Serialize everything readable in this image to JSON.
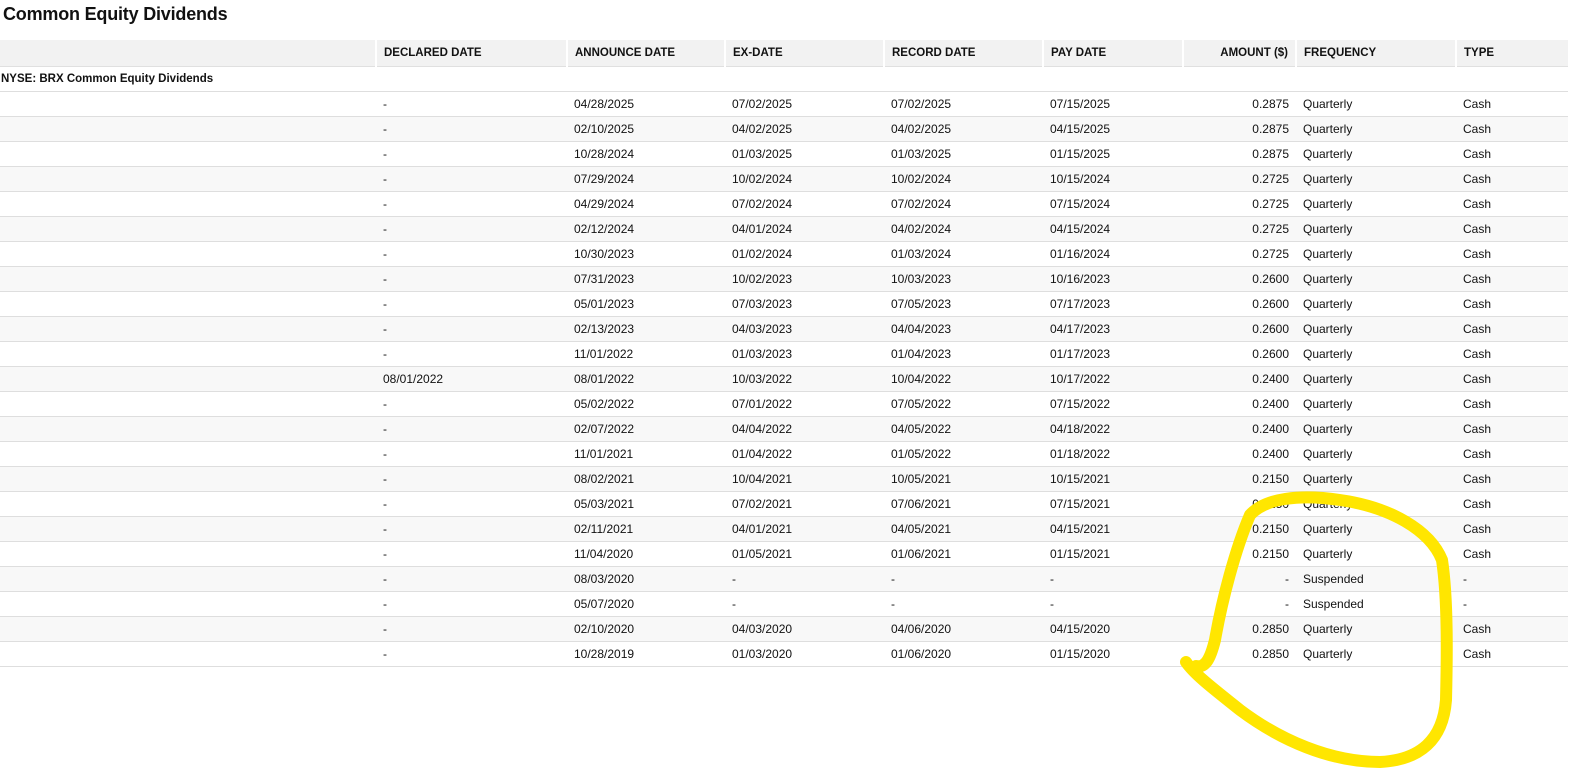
{
  "title": "Common Equity Dividends",
  "columns": [
    "",
    "DECLARED DATE",
    "ANNOUNCE DATE",
    "EX-DATE",
    "RECORD DATE",
    "PAY DATE",
    "AMOUNT ($)",
    "FREQUENCY",
    "TYPE"
  ],
  "group_label": "NYSE: BRX Common Equity Dividends",
  "annotation_color": "#ffe600",
  "rows": [
    [
      "-",
      "04/28/2025",
      "07/02/2025",
      "07/02/2025",
      "07/15/2025",
      "0.2875",
      "Quarterly",
      "Cash"
    ],
    [
      "-",
      "02/10/2025",
      "04/02/2025",
      "04/02/2025",
      "04/15/2025",
      "0.2875",
      "Quarterly",
      "Cash"
    ],
    [
      "-",
      "10/28/2024",
      "01/03/2025",
      "01/03/2025",
      "01/15/2025",
      "0.2875",
      "Quarterly",
      "Cash"
    ],
    [
      "-",
      "07/29/2024",
      "10/02/2024",
      "10/02/2024",
      "10/15/2024",
      "0.2725",
      "Quarterly",
      "Cash"
    ],
    [
      "-",
      "04/29/2024",
      "07/02/2024",
      "07/02/2024",
      "07/15/2024",
      "0.2725",
      "Quarterly",
      "Cash"
    ],
    [
      "-",
      "02/12/2024",
      "04/01/2024",
      "04/02/2024",
      "04/15/2024",
      "0.2725",
      "Quarterly",
      "Cash"
    ],
    [
      "-",
      "10/30/2023",
      "01/02/2024",
      "01/03/2024",
      "01/16/2024",
      "0.2725",
      "Quarterly",
      "Cash"
    ],
    [
      "-",
      "07/31/2023",
      "10/02/2023",
      "10/03/2023",
      "10/16/2023",
      "0.2600",
      "Quarterly",
      "Cash"
    ],
    [
      "-",
      "05/01/2023",
      "07/03/2023",
      "07/05/2023",
      "07/17/2023",
      "0.2600",
      "Quarterly",
      "Cash"
    ],
    [
      "-",
      "02/13/2023",
      "04/03/2023",
      "04/04/2023",
      "04/17/2023",
      "0.2600",
      "Quarterly",
      "Cash"
    ],
    [
      "-",
      "11/01/2022",
      "01/03/2023",
      "01/04/2023",
      "01/17/2023",
      "0.2600",
      "Quarterly",
      "Cash"
    ],
    [
      "08/01/2022",
      "08/01/2022",
      "10/03/2022",
      "10/04/2022",
      "10/17/2022",
      "0.2400",
      "Quarterly",
      "Cash"
    ],
    [
      "-",
      "05/02/2022",
      "07/01/2022",
      "07/05/2022",
      "07/15/2022",
      "0.2400",
      "Quarterly",
      "Cash"
    ],
    [
      "-",
      "02/07/2022",
      "04/04/2022",
      "04/05/2022",
      "04/18/2022",
      "0.2400",
      "Quarterly",
      "Cash"
    ],
    [
      "-",
      "11/01/2021",
      "01/04/2022",
      "01/05/2022",
      "01/18/2022",
      "0.2400",
      "Quarterly",
      "Cash"
    ],
    [
      "-",
      "08/02/2021",
      "10/04/2021",
      "10/05/2021",
      "10/15/2021",
      "0.2150",
      "Quarterly",
      "Cash"
    ],
    [
      "-",
      "05/03/2021",
      "07/02/2021",
      "07/06/2021",
      "07/15/2021",
      "0.2150",
      "Quarterly",
      "Cash"
    ],
    [
      "-",
      "02/11/2021",
      "04/01/2021",
      "04/05/2021",
      "04/15/2021",
      "0.2150",
      "Quarterly",
      "Cash"
    ],
    [
      "-",
      "11/04/2020",
      "01/05/2021",
      "01/06/2021",
      "01/15/2021",
      "0.2150",
      "Quarterly",
      "Cash"
    ],
    [
      "-",
      "08/03/2020",
      "-",
      "-",
      "-",
      "-",
      "Suspended",
      "-"
    ],
    [
      "-",
      "05/07/2020",
      "-",
      "-",
      "-",
      "-",
      "Suspended",
      "-"
    ],
    [
      "-",
      "02/10/2020",
      "04/03/2020",
      "04/06/2020",
      "04/15/2020",
      "0.2850",
      "Quarterly",
      "Cash"
    ],
    [
      "-",
      "10/28/2019",
      "01/03/2020",
      "01/06/2020",
      "01/15/2020",
      "0.2850",
      "Quarterly",
      "Cash"
    ]
  ]
}
